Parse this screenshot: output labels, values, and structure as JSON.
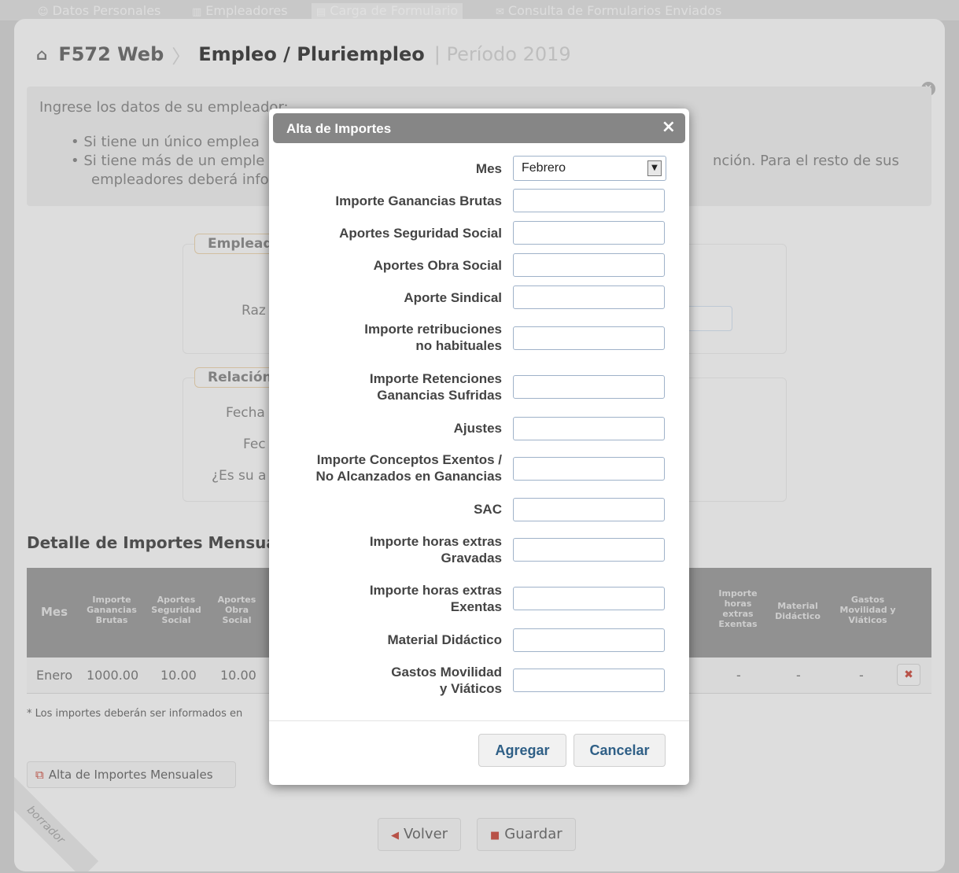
{
  "topnav": {
    "datos_personales": "Datos Personales",
    "empleadores": "Empleadores",
    "carga_formulario": "Carga de Formulario",
    "consulta": "Consulta de Formularios Enviados"
  },
  "breadcrumb": {
    "app": "F572 Web",
    "section": "Empleo / Pluriempleo",
    "period": "| Período 2019"
  },
  "info": {
    "intro": "Ingrese los datos de su empleador:",
    "bullet1": "• Si tiene un único emplea",
    "bullet2": "• Si tiene más de un emple",
    "bullet2_tail": "nción. Para el resto de sus",
    "bullet3": "empleadores deberá info"
  },
  "empleador_section": {
    "legend": "Emplead",
    "razon_label": "Raz"
  },
  "relacion_section": {
    "legend": "Relación",
    "fecha1_label": "Fecha",
    "fecha2_label": "Fec",
    "es_su_label": "¿Es su a"
  },
  "detalle": {
    "title": "Detalle de Importes Mensuale",
    "columns": [
      "Mes",
      "Importe Ganancias Brutas",
      "Aportes Seguridad Social",
      "Aportes Obra Social",
      "Importe horas extras Exentas",
      "Material Didáctico",
      "Gastos Movilidad y Viáticos"
    ],
    "row": {
      "mes": "Enero",
      "ganancias": "1000.00",
      "seguridad": "10.00",
      "obra": "10.00",
      "horas_exentas": "-",
      "material": "-",
      "gastos": "-"
    },
    "footnote": "* Los importes deberán ser informados en"
  },
  "alta_button": "Alta de Importes Mensuales",
  "volver_button": "Volver",
  "guardar_button": "Guardar",
  "ribbon": "borrador",
  "modal": {
    "title": "Alta de Importes",
    "close": "×",
    "mes_label": "Mes",
    "mes_value": "Febrero",
    "fields": [
      {
        "label": "Importe Ganancias Brutas"
      },
      {
        "label": "Aportes Seguridad Social"
      },
      {
        "label": "Aportes Obra Social"
      },
      {
        "label": "Aporte Sindical"
      },
      {
        "label_l1": "Importe retribuciones",
        "label_l2": "no habituales"
      },
      {
        "label_l1": "Importe Retenciones",
        "label_l2": "Ganancias Sufridas"
      },
      {
        "label": "Ajustes"
      },
      {
        "label_l1": "Importe Conceptos Exentos /",
        "label_l2": "No Alcanzados en Ganancias"
      },
      {
        "label": "SAC"
      },
      {
        "label_l1": "Importe horas extras",
        "label_l2": "Gravadas"
      },
      {
        "label_l1": "Importe horas extras",
        "label_l2": "Exentas"
      },
      {
        "label": "Material Didáctico"
      },
      {
        "label_l1": "Gastos Movilidad",
        "label_l2": "y Viáticos"
      }
    ],
    "agregar": "Agregar",
    "cancelar": "Cancelar"
  }
}
